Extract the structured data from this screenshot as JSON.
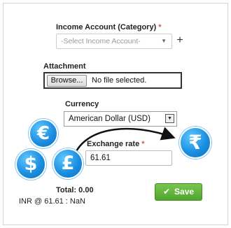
{
  "income_account": {
    "label": "Income Account (Category)",
    "required_mark": "*",
    "placeholder": "-Select Income Account-",
    "add_label": "+"
  },
  "attachment": {
    "label": "Attachment",
    "browse_label": "Browse...",
    "file_status": "No file selected."
  },
  "currency": {
    "label": "Currency",
    "selected": "American Dollar (USD)"
  },
  "exchange_rate": {
    "label": "Exchange rate",
    "required_mark": "*",
    "value": "61.61"
  },
  "coins": {
    "euro": "€",
    "dollar": "$",
    "pound": "£",
    "rupee": "₹"
  },
  "summary": {
    "total": "Total: 0.00",
    "inr_line": "INR @ 61.61 : NaN"
  },
  "save_button": {
    "check": "✔",
    "label": "Save"
  }
}
